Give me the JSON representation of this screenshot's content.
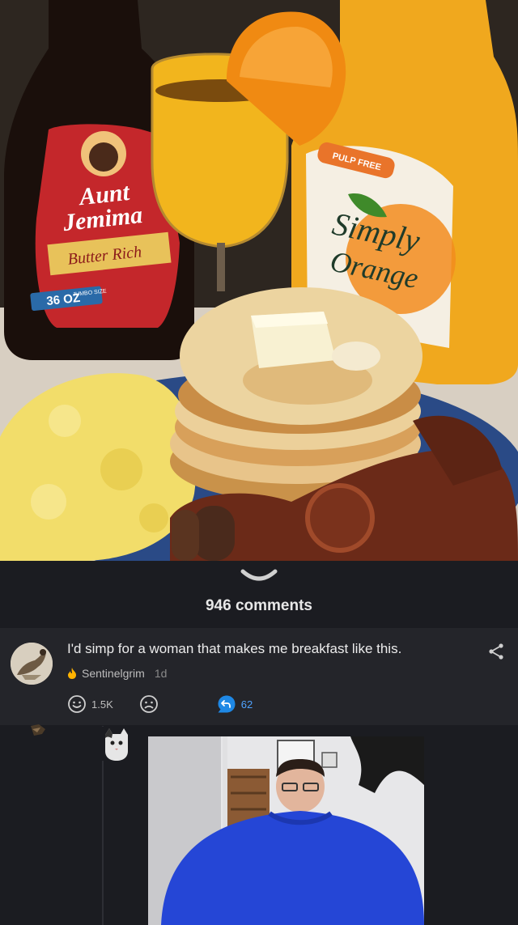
{
  "post": {
    "image_brands": {
      "syrup_brand_line1": "Aunt",
      "syrup_brand_line2": "Jemima",
      "syrup_variant": "Butter Rich",
      "syrup_size": "36 OZ",
      "syrup_size_tag": "JUMBO SIZE",
      "juice_tag": "PULP FREE",
      "juice_brand_line1": "Simply",
      "juice_brand_line2": "Orange"
    }
  },
  "comments_bar": {
    "count_label": "946 comments"
  },
  "comment": {
    "text": "I'd simp for a woman that makes me breakfast like this.",
    "author": "Sentinelgrim",
    "age": "1d",
    "upvotes": "1.5K",
    "replies": "62"
  },
  "colors": {
    "background": "#1b1c21",
    "card": "#24252a",
    "accent_blue": "#1e88e5",
    "flame": "#ffb300"
  },
  "icons": {
    "collapse": "chevron-down-icon",
    "share": "share-icon",
    "flair": "flame-icon",
    "upvote": "smile-face-icon",
    "downvote": "frown-face-icon",
    "reply": "reply-arrow-icon"
  }
}
